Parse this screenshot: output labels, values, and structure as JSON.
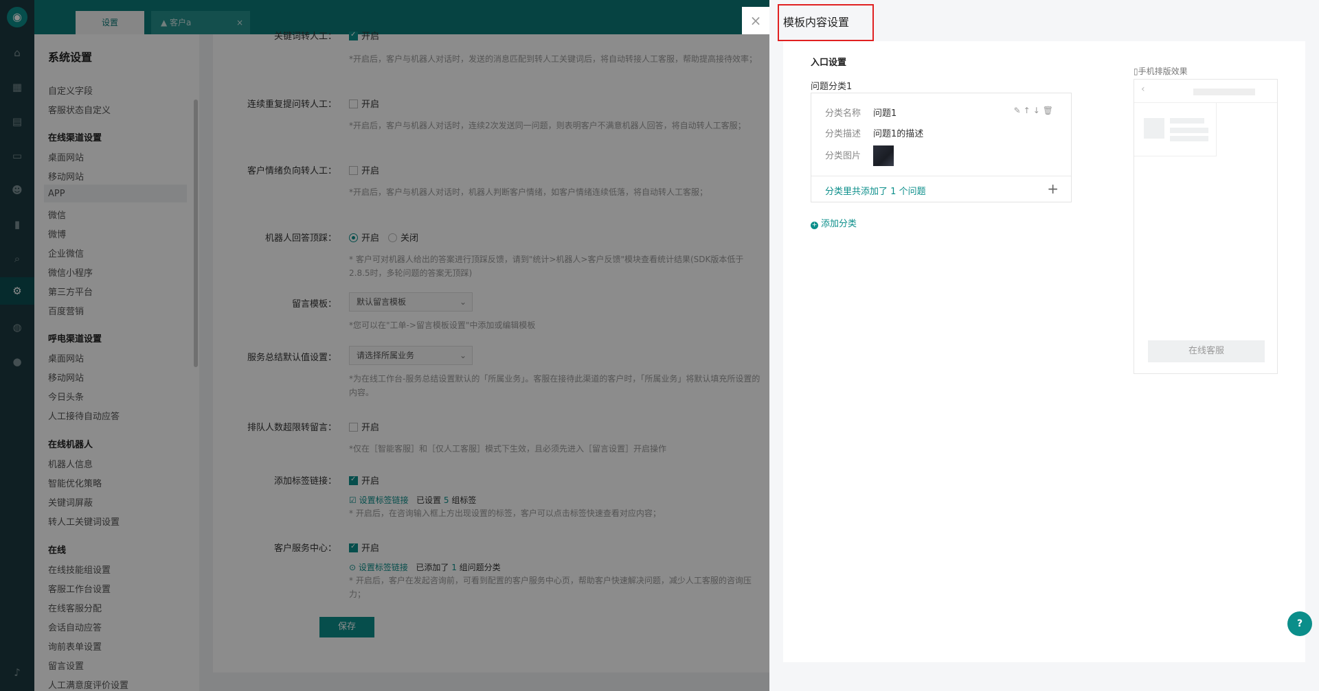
{
  "tabs": {
    "settings": "设置",
    "customer": "客户a",
    "close": "×"
  },
  "menu": {
    "title": "系统设置",
    "items_top": [
      "自定义字段",
      "客服状态自定义"
    ],
    "groups": [
      {
        "head": "在线渠道设置",
        "items": [
          "桌面网站",
          "移动网站",
          "APP",
          "微信",
          "微博",
          "企业微信",
          "微信小程序",
          "第三方平台",
          "百度营销"
        ]
      },
      {
        "head": "呼电渠道设置",
        "items": [
          "桌面网站",
          "移动网站",
          "今日头条",
          "人工接待自动应答"
        ]
      },
      {
        "head": "在线机器人",
        "items": [
          "机器人信息",
          "智能优化策略",
          "关键词屏蔽",
          "转人工关键词设置"
        ]
      },
      {
        "head": "在线",
        "items": [
          "在线技能组设置",
          "客服工作台设置",
          "在线客服分配",
          "会话自动应答",
          "询前表单设置",
          "留言设置",
          "人工满意度评价设置"
        ]
      }
    ]
  },
  "form": {
    "r0_label": "关键词转人工：",
    "r0_opt": "开启",
    "r0_hint": "*开启后，客户与机器人对话时，发送的消息匹配到转人工关键词后，将自动转接人工客服，帮助提高接待效率；",
    "r1_label": "连续重复提问转人工：",
    "r1_opt": "开启",
    "r1_hint": "*开启后，客户与机器人对话时，连续2次发送同一问题，则表明客户不满意机器人回答，将自动转人工客服；",
    "r2_label": "客户情绪负向转人工：",
    "r2_opt": "开启",
    "r2_hint": "*开启后，客户与机器人对话时，机器人判断客户情绪，如客户情绪连续低落，将自动转人工客服；",
    "r3_label": "机器人回答顶踩：",
    "r3_on": "开启",
    "r3_off": "关闭",
    "r3_hint": "* 客户可对机器人给出的答案进行顶踩反馈，请到\"统计>机器人>客户反馈\"模块查看统计结果(SDK版本低于2.8.5时，多轮问题的答案无顶踩)",
    "r4_label": "留言模板：",
    "r4_value": "默认留言模板",
    "r4_hint": "*您可以在\"工单->留言模板设置\"中添加或编辑模板",
    "r5_label": "服务总结默认值设置：",
    "r5_value": "请选择所属业务",
    "r5_hint": "*为在线工作台-服务总结设置默认的「所属业务」。客服在接待此渠道的客户时，「所属业务」将默认填充所设置的内容。",
    "r6_label": "排队人数超限转留言：",
    "r6_opt": "开启",
    "r6_hint": "*仅在［智能客服］和［仅人工客服］模式下生效，且必须先进入［留言设置］开启操作",
    "r7_label": "添加标签链接：",
    "r7_opt": "开启",
    "r7_link": "设置标签链接",
    "r7_status_pre": "已设置",
    "r7_status_num": "5",
    "r7_status_post": "组标签",
    "r7_hint": "* 开启后，在咨询输入框上方出现设置的标签，客户可以点击标签快速查看对应内容；",
    "r8_label": "客户服务中心：",
    "r8_opt": "开启",
    "r8_link": "设置标签链接",
    "r8_status_pre": "已添加了",
    "r8_status_num": "1",
    "r8_status_post": "组问题分类",
    "r8_hint": "* 开启后，客户在发起咨询前，可看到配置的客户服务中心页，帮助客户快速解决问题，减少人工客服的咨询压力；",
    "save": "保存"
  },
  "drawer": {
    "close": "×",
    "title": "模板内容设置",
    "section": "入口设置",
    "category_title": "问题分类1",
    "name_key": "分类名称",
    "name_val": "问题1",
    "desc_key": "分类描述",
    "desc_val": "问题1的描述",
    "img_key": "分类图片",
    "foot_pre": "分类里共添加了",
    "foot_num": "1",
    "foot_post": "个问题",
    "add_category": "添加分类",
    "phone_label": "手机排版效果",
    "phone_service": "在线客服"
  }
}
